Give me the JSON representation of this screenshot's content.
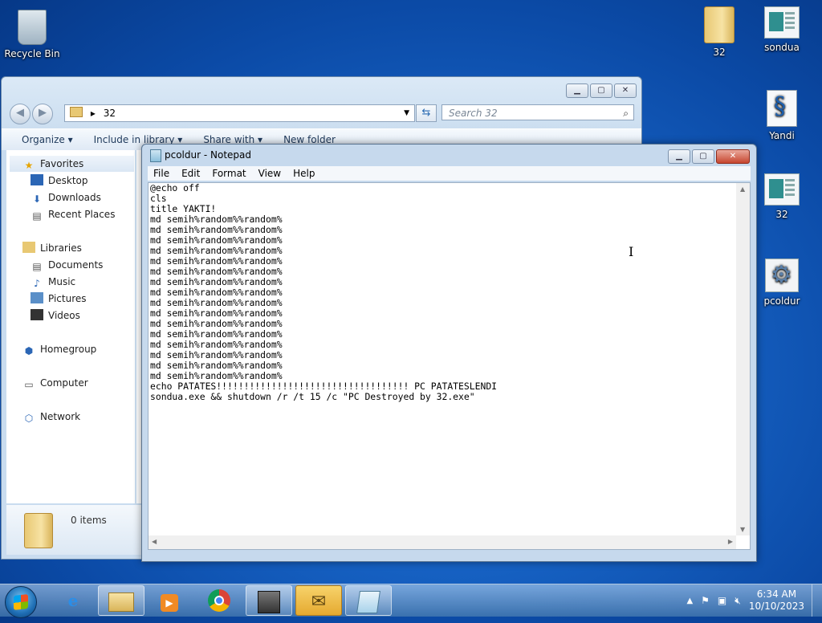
{
  "desktop": {
    "icons": {
      "recycle_bin": "Recycle Bin",
      "folder_32": "32",
      "sondua": "sondua",
      "yandi": "Yandi",
      "app_32": "32",
      "pcoldur": "pcoldur"
    }
  },
  "explorer": {
    "address": "32",
    "search_placeholder": "Search 32",
    "toolbar": {
      "organize": "Organize ▾",
      "include_in_library": "Include in library ▾",
      "share_with": "Share with ▾",
      "new_folder": "New folder"
    },
    "nav": {
      "favorites": "Favorites",
      "desktop": "Desktop",
      "downloads": "Downloads",
      "recent_places": "Recent Places",
      "libraries": "Libraries",
      "documents": "Documents",
      "music": "Music",
      "pictures": "Pictures",
      "videos": "Videos",
      "homegroup": "Homegroup",
      "computer": "Computer",
      "network": "Network"
    },
    "details": "0 items"
  },
  "notepad": {
    "title": "pcoldur - Notepad",
    "menu": {
      "file": "File",
      "edit": "Edit",
      "format": "Format",
      "view": "View",
      "help": "Help"
    },
    "content": "@echo off\ncls\ntitle YAKTI!\nmd semih%random%%random%\nmd semih%random%%random%\nmd semih%random%%random%\nmd semih%random%%random%\nmd semih%random%%random%\nmd semih%random%%random%\nmd semih%random%%random%\nmd semih%random%%random%\nmd semih%random%%random%\nmd semih%random%%random%\nmd semih%random%%random%\nmd semih%random%%random%\nmd semih%random%%random%\nmd semih%random%%random%\nmd semih%random%%random%\nmd semih%random%%random%\necho PATATES!!!!!!!!!!!!!!!!!!!!!!!!!!!!!!!!!!! PC PATATESLENDI\nsondua.exe && shutdown /r /t 15 /c \"PC Destroyed by 32.exe\""
  },
  "taskbar": {
    "apps": [
      "start",
      "internet-explorer",
      "file-explorer",
      "media-player",
      "chrome",
      "app-window",
      "mail",
      "notepad"
    ]
  },
  "tray": {
    "time": "6:34 AM",
    "date": "10/10/2023"
  },
  "colors": {
    "desktop_bg": "#1763c5",
    "window_frame": "#c6d9ed",
    "close_button": "#c7462f"
  }
}
